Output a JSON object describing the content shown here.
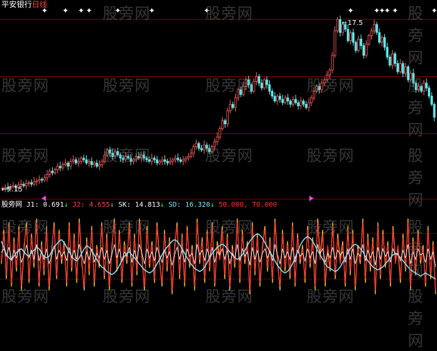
{
  "title": {
    "name": "平安银行",
    "period": "日线"
  },
  "watermark": "股旁网",
  "price_panel": {
    "high_label": "17.5",
    "low_label": "7.15",
    "arrow": "←"
  },
  "indicator_header": {
    "source": "股旁网",
    "items": [
      {
        "label": "J1:",
        "value": "0.691",
        "arrow": "↓",
        "color": "#ffffff"
      },
      {
        "label": "J2:",
        "value": "4.655",
        "arrow": "↓",
        "color": "#ff4040"
      },
      {
        "label": "SK:",
        "value": "14.813",
        "arrow": "↓",
        "color": "#ffffff"
      },
      {
        "label": "SD:",
        "value": "16.320",
        "arrow": "↓",
        "color": "#7fe8ff"
      },
      {
        "label": "",
        "value": "50.000,",
        "arrow": "",
        "color": "#ff3030"
      },
      {
        "label": "",
        "value": "T0.000",
        "arrow": "",
        "color": "#ff3030"
      }
    ]
  },
  "colors": {
    "up": "#ff5a5a",
    "down": "#5fe8e8",
    "grid": "#8b0000",
    "j1": "#ffc020",
    "j2": "#ff3030",
    "sk": "#ffffff",
    "sd": "#8feaff",
    "marker": "#ffffff",
    "magenta": "#ff40ff"
  },
  "chart_data": [
    {
      "type": "candlestick",
      "title": "平安银行 日线",
      "ylim": [
        6.8,
        18.2
      ],
      "grid_levels": [
        17.6,
        14.1,
        10.6
      ],
      "close": [
        7.25,
        7.3,
        7.2,
        7.35,
        7.4,
        7.3,
        7.45,
        7.5,
        7.4,
        7.55,
        7.6,
        7.5,
        7.65,
        7.7,
        7.8,
        7.75,
        7.9,
        8.1,
        8.3,
        8.2,
        8.4,
        8.6,
        8.5,
        8.7,
        8.8,
        8.6,
        8.9,
        9.0,
        8.8,
        8.9,
        9.1,
        9.0,
        8.8,
        8.9,
        8.7,
        8.8,
        8.6,
        8.7,
        8.9,
        9.3,
        9.6,
        9.4,
        9.2,
        9.5,
        9.3,
        9.1,
        9.0,
        9.2,
        9.1,
        8.9,
        9.0,
        9.2,
        9.1,
        9.3,
        9.1,
        9.0,
        8.9,
        9.1,
        9.0,
        8.8,
        8.9,
        9.0,
        8.9,
        8.8,
        8.9,
        9.0,
        9.1,
        9.0,
        8.9,
        9.0,
        9.1,
        9.2,
        9.4,
        9.8,
        10.0,
        9.7,
        9.6,
        9.9,
        9.7,
        9.5,
        9.8,
        10.1,
        10.4,
        10.9,
        11.4,
        11.2,
        12.0,
        12.4,
        12.2,
        12.8,
        13.3,
        13.0,
        13.5,
        13.9,
        13.6,
        13.2,
        13.8,
        14.1,
        13.7,
        13.4,
        13.9,
        13.6,
        13.2,
        12.9,
        12.6,
        12.9,
        12.7,
        12.5,
        12.8,
        12.6,
        12.4,
        12.7,
        12.5,
        12.3,
        12.6,
        12.4,
        12.2,
        12.5,
        12.8,
        13.2,
        13.5,
        13.3,
        13.7,
        13.9,
        14.2,
        14.5,
        15.4,
        16.9,
        17.6,
        16.8,
        17.3,
        17.0,
        16.3,
        16.8,
        16.2,
        15.7,
        16.4,
        16.0,
        15.4,
        16.1,
        16.6,
        16.9,
        17.3,
        16.8,
        16.2,
        16.5,
        15.9,
        15.3,
        14.8,
        15.5,
        14.9,
        14.4,
        14.9,
        14.3,
        14.7,
        13.9,
        14.3,
        13.7,
        13.3,
        13.5,
        13.2,
        13.7,
        13.4,
        12.9,
        12.4,
        11.6
      ]
    },
    {
      "type": "line",
      "title": "J1 J2 SK SD",
      "ylim": [
        -20,
        110
      ],
      "grid_levels": [
        80,
        50,
        20
      ],
      "series": [
        {
          "name": "J1",
          "values": [
            40,
            85,
            20,
            95,
            10,
            75,
            30,
            90,
            5,
            60,
            95,
            15,
            80,
            35,
            100,
            10,
            70,
            25,
            90,
            5,
            55,
            95,
            20,
            85,
            40,
            70,
            10,
            95,
            30,
            80,
            15,
            100,
            45,
            5,
            75,
            25,
            90,
            10,
            65,
            35,
            95,
            20,
            80,
            5,
            60,
            100,
            30,
            85,
            15,
            70,
            40,
            95,
            10,
            80,
            25,
            100,
            50,
            5,
            90,
            35,
            70,
            15,
            95,
            45,
            10,
            85,
            30,
            75,
            0,
            60,
            95,
            20,
            80,
            10,
            90,
            35,
            65,
            5,
            100,
            40,
            75,
            15,
            85,
            30,
            95,
            10,
            70,
            50,
            90,
            20,
            80,
            5,
            65,
            35,
            100,
            15,
            85,
            40,
            70,
            0,
            95,
            25,
            80,
            10,
            60,
            90,
            30,
            75,
            15,
            100,
            45,
            5,
            85,
            30,
            70,
            20,
            95,
            10,
            80,
            40,
            65,
            15,
            90,
            35,
            75,
            5,
            100,
            50,
            85,
            10,
            60,
            30,
            95,
            20,
            80,
            45,
            70,
            10,
            90,
            25,
            85,
            5,
            65,
            40,
            100,
            15,
            80,
            30,
            75,
            0,
            95,
            20,
            85,
            35,
            70,
            10,
            90,
            45,
            60,
            15,
            80,
            30,
            100,
            5,
            75,
            25,
            85,
            40,
            65,
            10,
            90,
            20,
            70,
            0
          ]
        },
        {
          "name": "J2",
          "values": [
            45,
            80,
            25,
            90,
            15,
            70,
            35,
            85,
            10,
            65,
            90,
            20,
            75,
            40,
            95,
            15,
            65,
            30,
            85,
            10,
            60,
            90,
            25,
            80,
            45,
            65,
            15,
            90,
            35,
            75,
            20,
            95,
            40,
            10,
            70,
            30,
            85,
            15,
            60,
            40,
            90,
            25,
            75,
            10,
            65,
            95,
            35,
            80,
            20,
            65,
            45,
            90,
            15,
            75,
            30,
            95,
            45,
            10,
            85,
            40,
            65,
            20,
            90,
            40,
            15,
            80,
            35,
            70,
            5,
            65,
            90,
            25,
            75,
            15,
            85,
            40,
            60,
            10,
            95,
            45,
            70,
            20,
            80,
            35,
            90,
            15,
            65,
            45,
            85,
            25,
            75,
            10,
            60,
            40,
            95,
            20,
            80,
            45,
            65,
            5,
            90,
            30,
            75,
            15,
            65,
            85,
            35,
            70,
            20,
            95,
            40,
            10,
            80,
            35,
            65,
            25,
            90,
            15,
            75,
            45,
            60,
            20,
            85,
            40,
            70,
            10,
            95,
            45,
            80,
            15,
            65,
            35,
            90,
            25,
            75,
            40,
            65,
            15,
            85,
            30,
            80,
            10,
            60,
            45,
            95,
            20,
            75,
            35,
            70,
            5,
            90,
            25,
            80,
            40,
            65,
            15,
            85,
            40,
            65,
            20,
            75,
            35,
            95,
            10,
            70,
            30,
            80,
            45,
            60,
            15,
            85,
            25,
            65,
            5
          ]
        },
        {
          "name": "SK",
          "values": [
            55,
            60,
            50,
            62,
            45,
            58,
            48,
            60,
            42,
            52,
            65,
            48,
            58,
            46,
            66,
            44,
            56,
            46,
            60,
            40,
            50,
            64,
            46,
            58,
            50,
            56,
            44,
            62,
            48,
            58,
            46,
            66,
            52,
            40,
            56,
            46,
            60,
            42,
            54,
            48,
            62,
            46,
            58,
            40,
            52,
            66,
            48,
            60,
            44,
            56,
            50,
            62,
            42,
            58,
            46,
            66,
            54,
            40,
            60,
            48,
            56,
            44,
            62,
            52,
            42,
            58,
            48,
            56,
            38,
            52,
            62,
            46,
            58,
            42,
            60,
            50,
            54,
            40,
            66,
            52,
            58,
            44,
            60,
            48,
            62,
            42,
            56,
            52,
            60,
            46,
            58,
            40,
            54,
            48,
            66,
            44,
            60,
            50,
            56,
            38,
            62,
            46,
            58,
            42,
            54,
            60,
            48,
            56,
            44,
            66,
            52,
            40,
            60,
            48,
            56,
            46,
            62,
            42,
            58,
            50,
            54,
            44,
            60,
            48,
            56,
            40,
            66,
            54,
            60,
            42,
            54,
            48,
            62,
            46,
            58,
            52,
            56,
            42,
            60,
            46,
            60,
            40,
            54,
            50,
            66,
            44,
            58,
            48,
            56,
            38,
            62,
            46,
            60,
            50,
            56,
            42,
            60,
            52,
            54,
            44,
            58,
            48,
            66,
            40,
            56,
            46,
            60,
            52,
            54,
            42,
            60,
            46,
            56,
            36
          ]
        },
        {
          "name": "SD",
          "values": [
            70,
            62,
            52,
            48,
            45,
            50,
            55,
            58,
            60,
            56,
            52,
            50,
            55,
            58,
            62,
            60,
            55,
            50,
            48,
            50,
            56,
            62,
            66,
            70,
            72,
            68,
            62,
            56,
            50,
            46,
            44,
            48,
            54,
            60,
            64,
            62,
            58,
            52,
            46,
            40,
            36,
            34,
            30,
            28,
            26,
            28,
            32,
            38,
            44,
            50,
            54,
            56,
            52,
            48,
            44,
            40,
            36,
            32,
            30,
            28,
            30,
            34,
            40,
            46,
            52,
            58,
            62,
            66,
            70,
            72,
            70,
            66,
            60,
            54,
            48,
            42,
            38,
            34,
            32,
            30,
            32,
            36,
            42,
            48,
            54,
            58,
            62,
            64,
            66,
            64,
            60,
            56,
            52,
            48,
            46,
            48,
            52,
            58,
            64,
            70,
            74,
            78,
            80,
            78,
            74,
            68,
            62,
            56,
            50,
            44,
            38,
            34,
            30,
            28,
            30,
            34,
            40,
            48,
            56,
            64,
            70,
            74,
            76,
            74,
            70,
            64,
            58,
            52,
            46,
            40,
            36,
            34,
            32,
            30,
            32,
            36,
            42,
            48,
            54,
            60,
            64,
            66,
            64,
            60,
            56,
            50,
            44,
            40,
            36,
            34,
            32,
            34,
            36,
            40,
            44,
            48,
            52,
            54,
            52,
            48,
            44,
            40,
            36,
            32,
            30,
            28,
            26,
            24,
            26,
            28,
            26,
            24,
            22,
            20
          ]
        }
      ]
    }
  ]
}
